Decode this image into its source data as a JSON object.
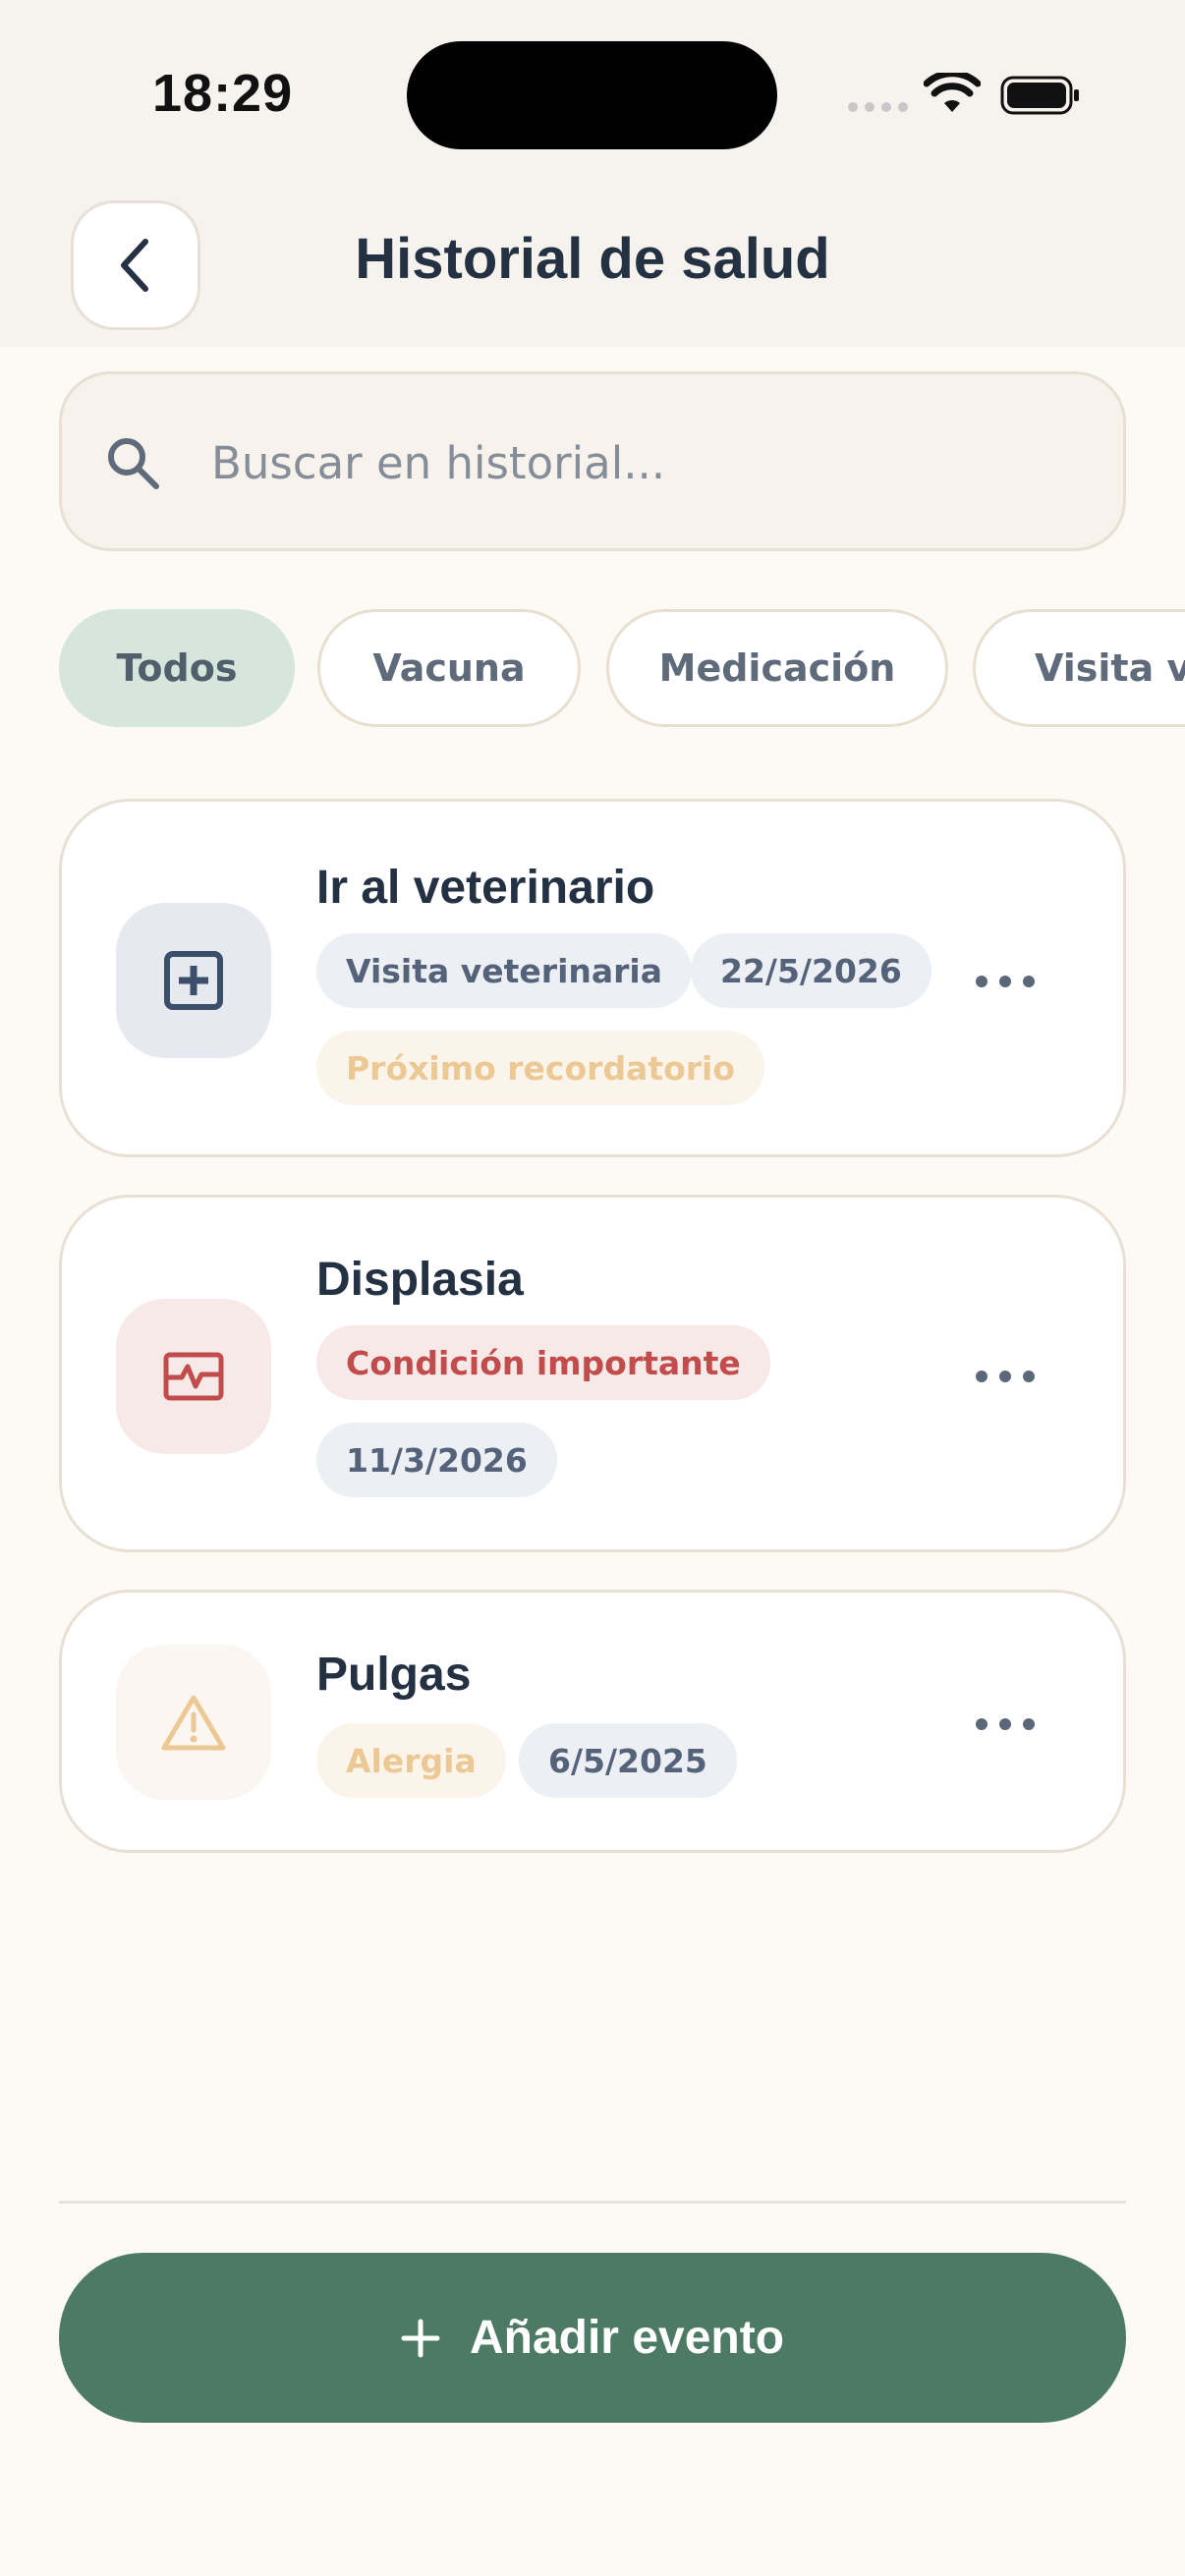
{
  "status_bar": {
    "time": "18:29"
  },
  "header": {
    "title": "Historial de salud"
  },
  "search": {
    "placeholder": "Buscar en historial..."
  },
  "filters": [
    {
      "label": "Todos",
      "active": true
    },
    {
      "label": "Vacuna",
      "active": false
    },
    {
      "label": "Medicación",
      "active": false
    },
    {
      "label": "Visita veterinaria",
      "active": false
    }
  ],
  "events": [
    {
      "title": "Ir al veterinario",
      "icon": "medical-plus-icon",
      "tags": [
        "Visita veterinaria",
        "22/5/2026",
        "Próximo recordatorio"
      ]
    },
    {
      "title": "Displasia",
      "icon": "heart-monitor-icon",
      "tags": [
        "Condición importante",
        "11/3/2026"
      ]
    },
    {
      "title": "Pulgas",
      "icon": "warning-triangle-icon",
      "tags": [
        "Alergia",
        "6/5/2025"
      ]
    }
  ],
  "footer": {
    "add_label": "Añadir evento"
  },
  "colors": {
    "accent_green": "#4c7a64",
    "active_chip": "#d6e6dc",
    "important_red": "#c24b4b",
    "reminder_amber": "#ecc894"
  }
}
